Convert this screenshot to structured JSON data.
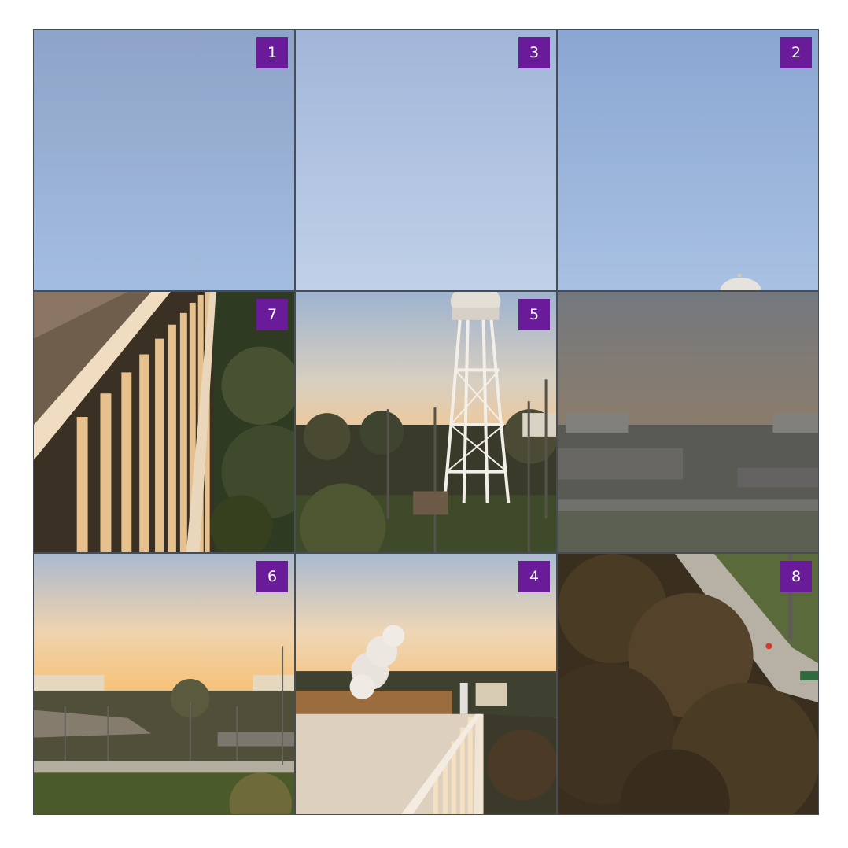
{
  "puzzle": {
    "tiles": [
      {
        "label": "1",
        "scene": "sky"
      },
      {
        "label": "3",
        "scene": "sky-light"
      },
      {
        "label": "2",
        "scene": "sky-tower-top"
      },
      {
        "label": "7",
        "scene": "railing"
      },
      {
        "label": "5",
        "scene": "water-tower"
      },
      {
        "label": "",
        "scene": "campus-empty"
      },
      {
        "label": "6",
        "scene": "campus-field"
      },
      {
        "label": "4",
        "scene": "steam-rooftop"
      },
      {
        "label": "8",
        "scene": "trees-path"
      }
    ]
  },
  "colors": {
    "badge": "#6a1b9a",
    "badge_text": "#ffffff",
    "empty_overlay": "#5f5f5f"
  }
}
